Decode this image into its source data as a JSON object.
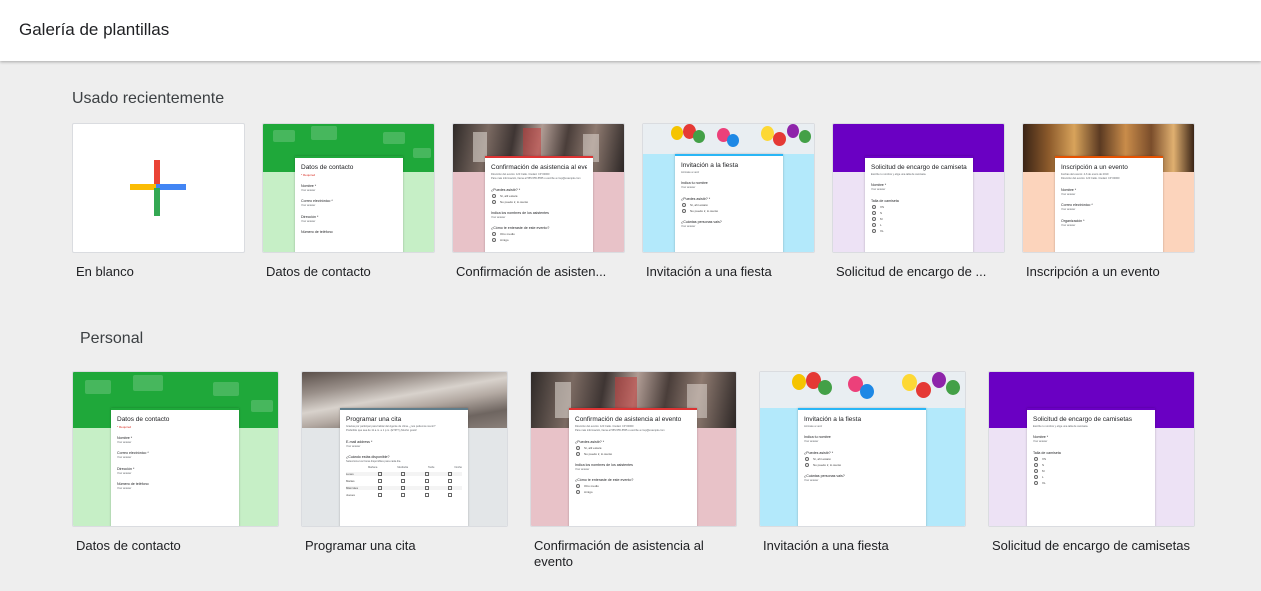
{
  "app": {
    "title": "Galería de plantillas"
  },
  "sections": {
    "recent": {
      "title": "Usado recientemente"
    },
    "personal": {
      "title": "Personal"
    }
  },
  "recent_cards": [
    {
      "label": "En blanco"
    },
    {
      "label": "Datos de contacto"
    },
    {
      "label": "Confirmación de asisten..."
    },
    {
      "label": "Invitación a una fiesta"
    },
    {
      "label": "Solicitud de encargo de ..."
    },
    {
      "label": "Inscripción a un evento"
    }
  ],
  "personal_cards": [
    {
      "label": "Datos de contacto"
    },
    {
      "label": "Programar una cita"
    },
    {
      "label": "Confirmación de asistencia al evento"
    },
    {
      "label": "Invitación a una fiesta"
    },
    {
      "label": "Solicitud de encargo de camisetas"
    }
  ],
  "previews": {
    "contact": {
      "title": "Datos de contacto",
      "required": "* Required",
      "q1": "Nombre *",
      "q2": "Correo electrónico *",
      "q3": "Dirección *",
      "q4": "Número de teléfono",
      "placeholder": "Your answer"
    },
    "appointment": {
      "title": "Programar una cita",
      "desc1": "Gracias por participar para hablar del Agente de clima. ¿nos podemos reunir?",
      "desc2": "Preferible que sea de 11 a.m. a 1 p.m. (ET/PT) ¡Mucho gusto!",
      "q1": "E-mail address *",
      "q2": "¿Cuándo estás disponible?",
      "q2sub": "Selecciona tus horas disponibles para cada día.",
      "cols": [
        "Mañana",
        "Mediodía",
        "Tarde",
        "Noche"
      ],
      "rows": [
        "Lunes",
        "Martes",
        "Miércoles",
        "Jueves"
      ],
      "placeholder": "Your answer"
    },
    "rsvp": {
      "title": "Confirmación de asistencia al evento",
      "desc1": "Dirección del evento: 123 Calle. Ciudad. CP 00000",
      "desc2": "Para más información, llama al 555-555-5555 o escribe a rsvp@example.com",
      "q1": "¿Puedes asistir? *",
      "o1": "Sí, allí estaré",
      "o2": "No puedo ir, lo siento",
      "q2": "Indica los nombres de los asistentes",
      "q3": "¿Cómo te enteraste de este evento?",
      "o3": "Otro medio",
      "o4": "Amigo",
      "placeholder": "Your answer"
    },
    "party": {
      "title": "Invitación a la fiesta",
      "desc": "Anímate a venir",
      "q1": "Indica tu nombre",
      "q2": "¿Puedes asistir? *",
      "o1": "Sí, ahí estaré",
      "o2": "No puedo ir, lo siento",
      "q3": "¿Cuántas personas vais?",
      "placeholder": "Your answer"
    },
    "tshirt": {
      "title": "Solicitud de encargo de camisetas",
      "desc": "Escribe tu nombre y elige una talla de camiseta.",
      "q1": "Nombre *",
      "q2": "Talla de camiseta",
      "sizes": [
        "XS",
        "S",
        "M",
        "L",
        "XL"
      ],
      "placeholder": "Your answer"
    },
    "event": {
      "title": "Inscripción a un evento",
      "desc1": "Fechas del evento: 4-6 de enero de 2019",
      "desc2": "Dirección del evento: 123 Calle. Ciudad. CP 00000",
      "q1": "Nombre *",
      "q2": "Correo electrónico *",
      "q3": "Organización *",
      "placeholder": "Your answer"
    }
  },
  "colors": {
    "contact_green": "#1fa83a",
    "contact_light": "#c6efc6",
    "rsvp_pink": "#e8c2c8",
    "party_blue": "#b3e9fb",
    "tshirt_purple": "#6a00c3",
    "tshirt_light": "#ede2f5",
    "event_peach": "#fcd4bc"
  }
}
